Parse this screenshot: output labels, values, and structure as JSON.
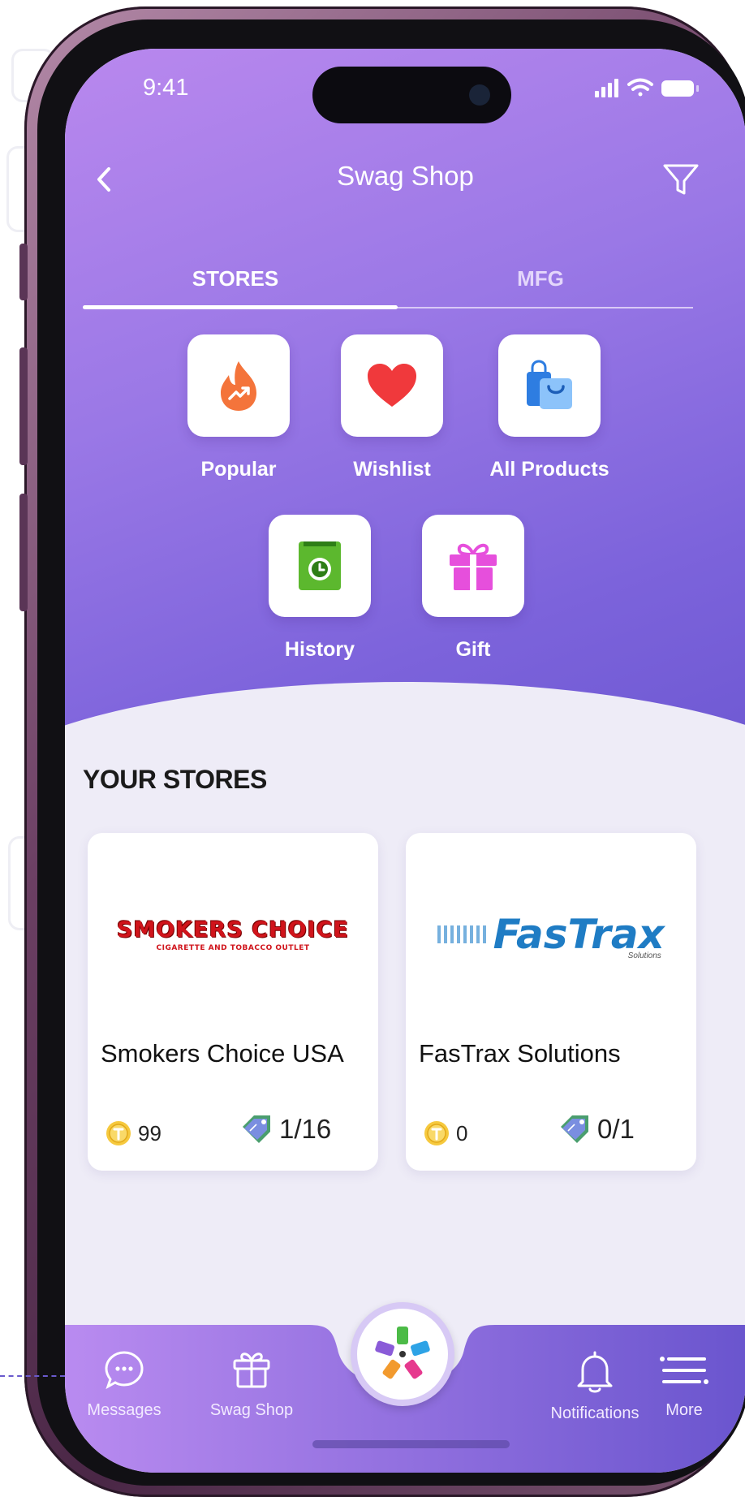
{
  "status_bar": {
    "time": "9:41"
  },
  "app_bar": {
    "title": "Swag Shop"
  },
  "tabs": [
    {
      "label": "STORES",
      "active": true
    },
    {
      "label": "MFG",
      "active": false
    }
  ],
  "shortcuts": [
    {
      "label": "Popular",
      "icon": "fire-trending-icon",
      "color": "#F4743B"
    },
    {
      "label": "Wishlist",
      "icon": "heart-icon",
      "color": "#F0393C"
    },
    {
      "label": "All Products",
      "icon": "shopping-bags-icon",
      "color": "#2E7DE1"
    },
    {
      "label": "History",
      "icon": "history-book-icon",
      "color": "#5CB82E"
    },
    {
      "label": "Gift",
      "icon": "gift-icon",
      "color": "#E64FDC"
    }
  ],
  "section": {
    "title": "YOUR STORES"
  },
  "stores": [
    {
      "name": "Smokers Choice USA",
      "logo_text": "SMOKERS CHOICE",
      "logo_subtext": "CIGARETTE AND TOBACCO OUTLET",
      "coins": "99",
      "tags": "1/16"
    },
    {
      "name": "FasTrax Solutions",
      "logo_text": "FasTrax",
      "logo_subtext": "Solutions",
      "coins": "0",
      "tags": "0/1"
    }
  ],
  "bottom_nav": {
    "items": [
      {
        "label": "Messages",
        "icon": "chat-bubble-icon"
      },
      {
        "label": "Swag Shop",
        "icon": "gift-icon"
      },
      {
        "label": "Notifications",
        "icon": "bell-icon"
      },
      {
        "label": "More",
        "icon": "menu-icon"
      }
    ]
  },
  "colors": {
    "hero_top": "#B988EE",
    "hero_bottom": "#6D58D2",
    "nav_left": "#B98BF0",
    "nav_right": "#6A55CE",
    "screen_bg": "#EEECF7"
  }
}
